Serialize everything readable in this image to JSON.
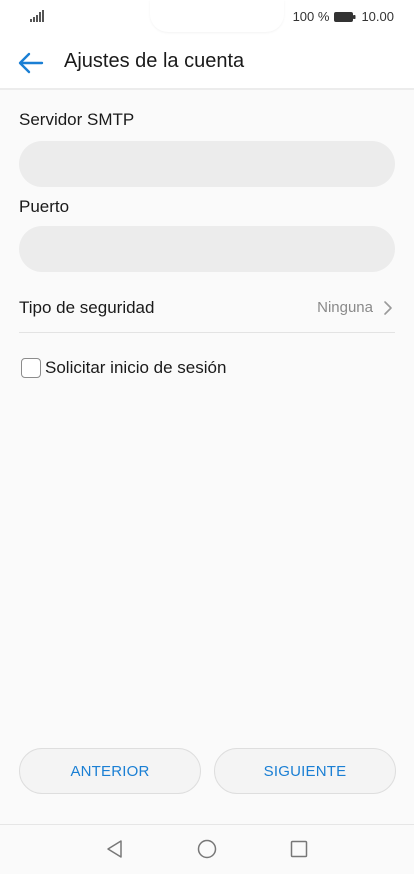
{
  "status_bar": {
    "battery_percent": "100 %",
    "time": "10.00",
    "signal_icon": "signal-icon",
    "battery_icon": "battery-icon"
  },
  "header": {
    "title": "Ajustes de la cuenta",
    "back_icon": "arrow-left-icon"
  },
  "form": {
    "smtp_server": {
      "label": "Servidor SMTP",
      "value": "",
      "placeholder": ""
    },
    "port": {
      "label": "Puerto",
      "value": "",
      "placeholder": ""
    },
    "security": {
      "label": "Tipo de seguridad",
      "value": "Ninguna",
      "icon": "chevron-right-icon"
    },
    "require_login": {
      "label": "Solicitar inicio de sesión",
      "checked": false
    }
  },
  "actions": {
    "previous_label": "ANTERIOR",
    "next_label": "SIGUIENTE"
  },
  "nav_bar": {
    "back_icon": "nav-back-icon",
    "home_icon": "nav-home-icon",
    "recents_icon": "nav-recents-icon"
  },
  "colors": {
    "accent": "#1a7fd4",
    "background": "#fafafa",
    "input_background": "#ececec"
  }
}
